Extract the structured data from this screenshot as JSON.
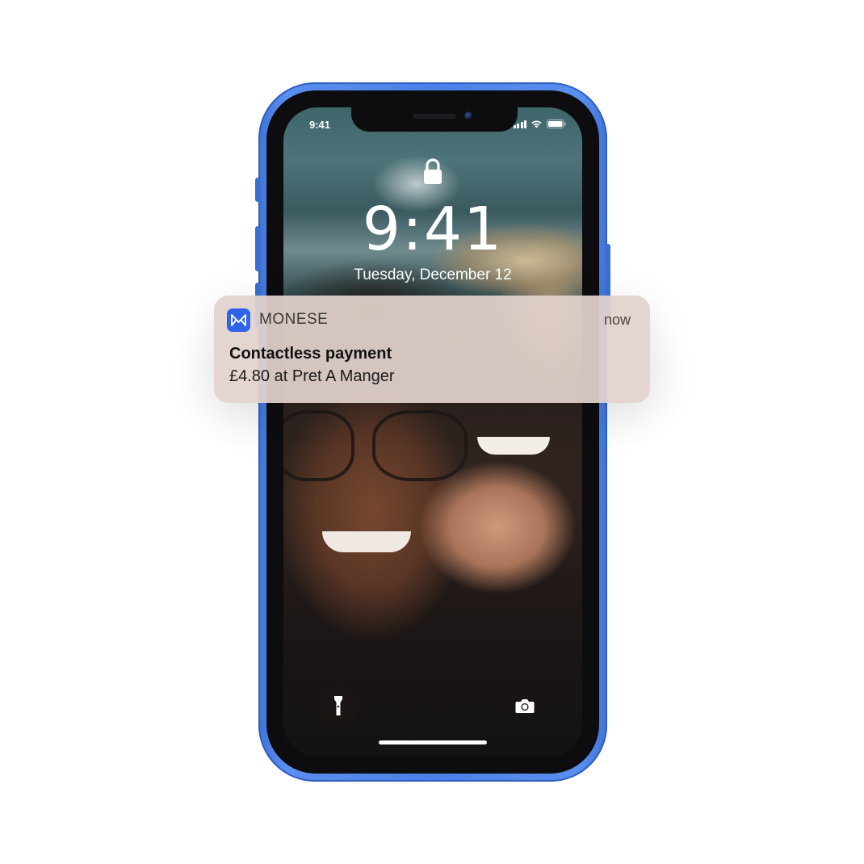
{
  "status_bar": {
    "time": "9:41",
    "icons": [
      "signal-icon",
      "wifi-icon",
      "battery-icon"
    ]
  },
  "lock_screen": {
    "lock_icon": "lock-icon",
    "time": "9:41",
    "date": "Tuesday, December 12",
    "quick_actions": [
      "flashlight-icon",
      "camera-icon"
    ]
  },
  "notification": {
    "app_icon": "monese-logo-icon",
    "app_name": "MONESE",
    "time": "now",
    "title": "Contactless payment",
    "body": "£4.80 at Pret A Manger"
  },
  "colors": {
    "phone_body": "#4a80e6",
    "app_accent": "#2f63e8",
    "notification_bg": "#e2d2cc"
  }
}
